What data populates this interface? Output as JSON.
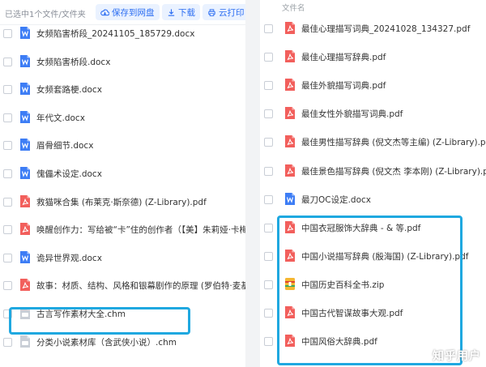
{
  "left": {
    "toolbar": {
      "selected_text": "已选中1个文件/文件夹",
      "save_label": "保存到网盘",
      "download_label": "下载",
      "print_label": "云打印"
    },
    "files": [
      {
        "name": "女频陷害桥段_20241105_185729.docx",
        "type": "word"
      },
      {
        "name": "女频陷害桥段.docx",
        "type": "word"
      },
      {
        "name": "女频套路梗.docx",
        "type": "word"
      },
      {
        "name": "年代文.docx",
        "type": "word"
      },
      {
        "name": "眉骨细节.docx",
        "type": "word"
      },
      {
        "name": "傀儡术设定.docx",
        "type": "word"
      },
      {
        "name": "救猫咪合集 (布莱克·斯奈德) (Z-Library).pdf",
        "type": "pdf"
      },
      {
        "name": "唤醒创作力：写给被“卡”住的创作者（【美】朱莉娅·卡梅伦庄云路译）",
        "type": "pdf"
      },
      {
        "name": "诡异世界观.docx",
        "type": "word"
      },
      {
        "name": "故事：材质、结构、风格和银幕剧作的原理 (罗伯特·麦基) (Z-Library",
        "type": "pdf"
      },
      {
        "name": "古言写作素材大全.chm",
        "type": "chm"
      },
      {
        "name": "分类小说素材库（含武侠小说）.chm",
        "type": "chm"
      }
    ]
  },
  "right": {
    "column_header": "文件名",
    "files": [
      {
        "name": "最佳心理描写词典_20241028_134327.pdf",
        "type": "pdf"
      },
      {
        "name": "最佳心理描写辞典.pdf",
        "type": "pdf"
      },
      {
        "name": "最佳外貌描写词典.pdf",
        "type": "pdf"
      },
      {
        "name": "最佳女性外貌描写词典.pdf",
        "type": "pdf"
      },
      {
        "name": "最佳男性描写辞典 (倪文杰等主编) (Z-Library).pdf",
        "type": "pdf"
      },
      {
        "name": "最佳景色描写辞典 (倪文杰 李本刚) (Z-Library).pdf",
        "type": "pdf"
      },
      {
        "name": "最刀OC设定.docx",
        "type": "word"
      },
      {
        "name": "中国衣冠服饰大辞典 - & 等.pdf",
        "type": "pdf"
      },
      {
        "name": "中国小说描写辞典 (殷海国) (Z-Library).pdf",
        "type": "pdf"
      },
      {
        "name": "中国历史百科全书.zip",
        "type": "zip"
      },
      {
        "name": "中国古代智谋故事大观.pdf",
        "type": "pdf"
      },
      {
        "name": "中国风俗大辞典.pdf",
        "type": "pdf"
      }
    ]
  },
  "watermark": "知乎用户",
  "colors": {
    "accent": "#2c6ef2",
    "highlight": "#1fa8e0",
    "word_icon": "#3d7df5",
    "pdf_icon": "#f25f5c",
    "chm_icon": "#c9ced6",
    "zip_icon": "#f5b731"
  }
}
